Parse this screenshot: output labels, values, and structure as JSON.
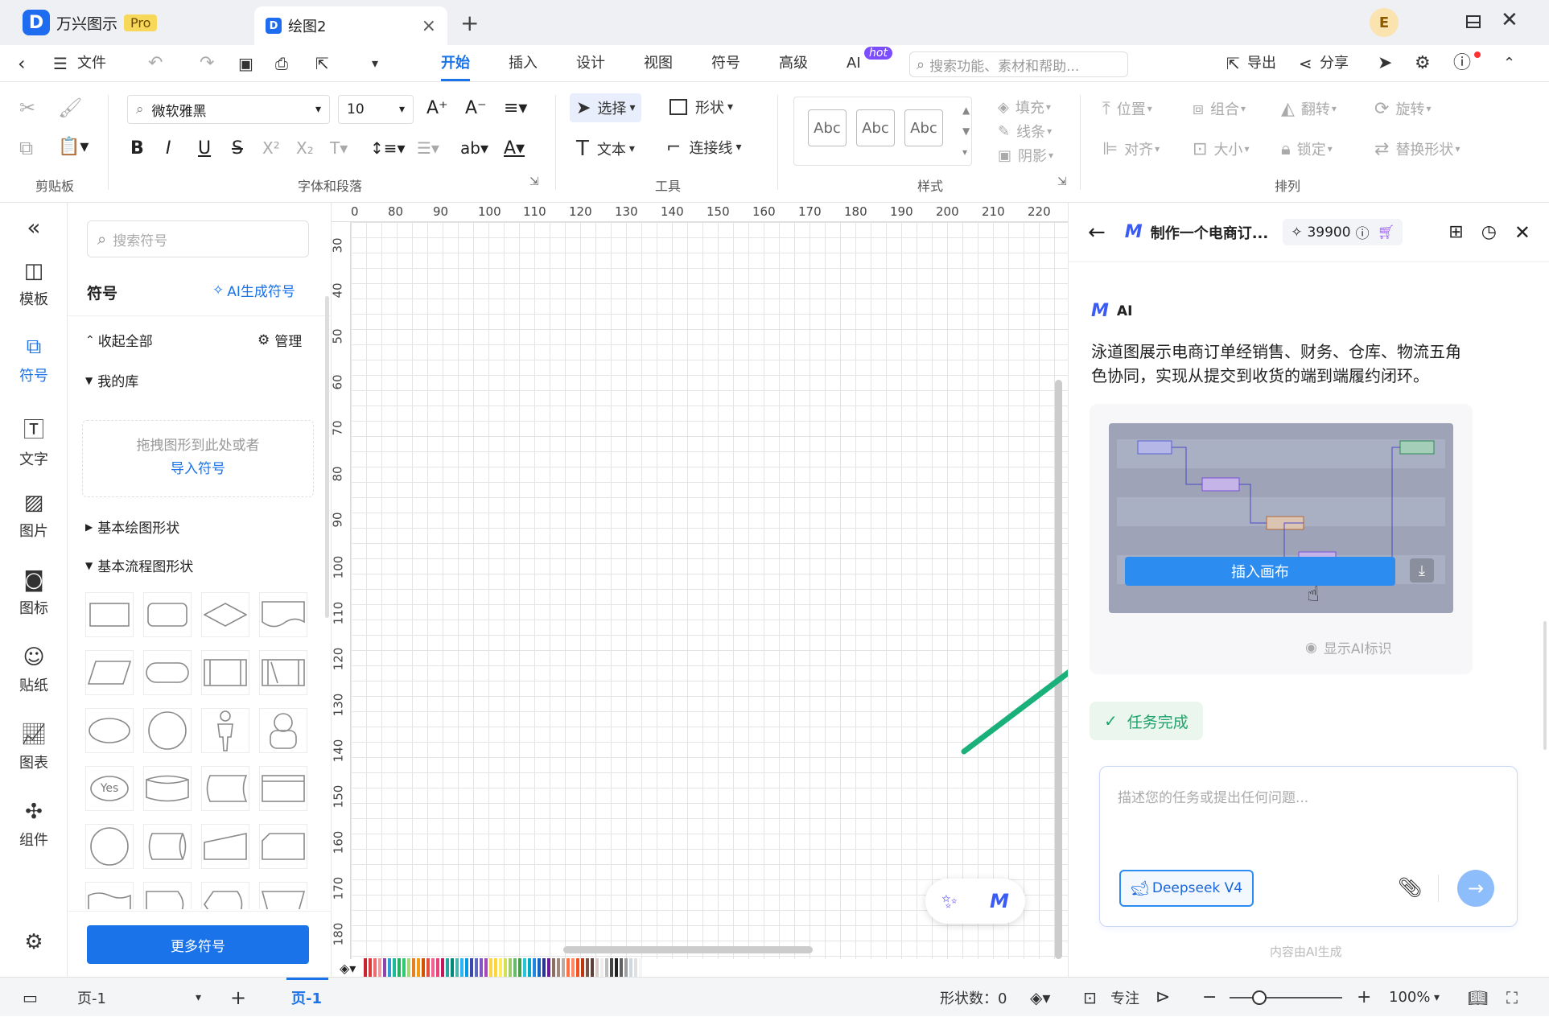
{
  "titlebar": {
    "app_name": "万兴图示",
    "pro_badge": "Pro",
    "doc_tab": "绘图2",
    "close_tab": "×",
    "new_tab": "+",
    "avatar_letter": "E"
  },
  "menubar": {
    "file": "文件",
    "tabs": [
      "开始",
      "插入",
      "设计",
      "视图",
      "符号",
      "高级",
      "AI"
    ],
    "hot_badge": "hot",
    "search_placeholder": "搜索功能、素材和帮助...",
    "export": "导出",
    "share": "分享"
  },
  "ribbon": {
    "font_name": "微软雅黑",
    "font_size": "10",
    "select": "选择",
    "shape": "形状",
    "text": "文本",
    "connector": "连接线",
    "style_samples": [
      "Abc",
      "Abc",
      "Abc"
    ],
    "fill": "填充",
    "line": "线条",
    "shadow": "阴影",
    "position": "位置",
    "group": "组合",
    "flip": "翻转",
    "rotate": "旋转",
    "align": "对齐",
    "size": "大小",
    "lock": "锁定",
    "replace_shape": "替换形状",
    "group_labels": {
      "clipboard": "剪贴板",
      "font": "字体和段落",
      "tools": "工具",
      "style": "样式",
      "arrange": "排列"
    }
  },
  "leftnav": {
    "items": [
      "模板",
      "符号",
      "文字",
      "图片",
      "图标",
      "贴纸",
      "图表",
      "组件"
    ]
  },
  "symbols": {
    "search_placeholder": "搜索符号",
    "title": "符号",
    "ai_generate": "AI生成符号",
    "collapse_all": "收起全部",
    "manage": "管理",
    "my_library": "我的库",
    "drop_hint": "拖拽图形到此处或者",
    "import_link": "导入符号",
    "basic_shapes": "基本绘图形状",
    "basic_flow": "基本流程图形状",
    "yes_label": "Yes",
    "more_button": "更多符号"
  },
  "canvas": {
    "ruler_h": [
      "0",
      "80",
      "90",
      "100",
      "110",
      "120",
      "130",
      "140",
      "150",
      "160",
      "170",
      "180",
      "190",
      "200",
      "210",
      "220"
    ],
    "ruler_v": [
      "30",
      "40",
      "50",
      "60",
      "70",
      "80",
      "90",
      "100",
      "110",
      "120",
      "130",
      "140",
      "150",
      "160",
      "170",
      "180"
    ]
  },
  "ai_panel": {
    "title": "制作一个电商订...",
    "credits": "39900",
    "ai_name": "AI",
    "message": "泳道图展示电商订单经销售、财务、仓库、物流五角色协同，实现从提交到收货的端到端履约闭环。",
    "insert_button": "插入画布",
    "show_ai_mark": "显示AI标识",
    "task_done": "任务完成",
    "input_placeholder": "描述您的任务或提出任何问题...",
    "model": "Deepseek V4",
    "footer": "内容由AI生成"
  },
  "statusbar": {
    "page_select": "页-1",
    "page_tab": "页-1",
    "shape_count": "形状数：0",
    "focus": "专注",
    "zoom": "100%"
  },
  "colors": {
    "accent": "#1a73e8",
    "insert_btn": "#2d8cf0",
    "success": "#1fa36a",
    "arrow": "#19b07a"
  }
}
